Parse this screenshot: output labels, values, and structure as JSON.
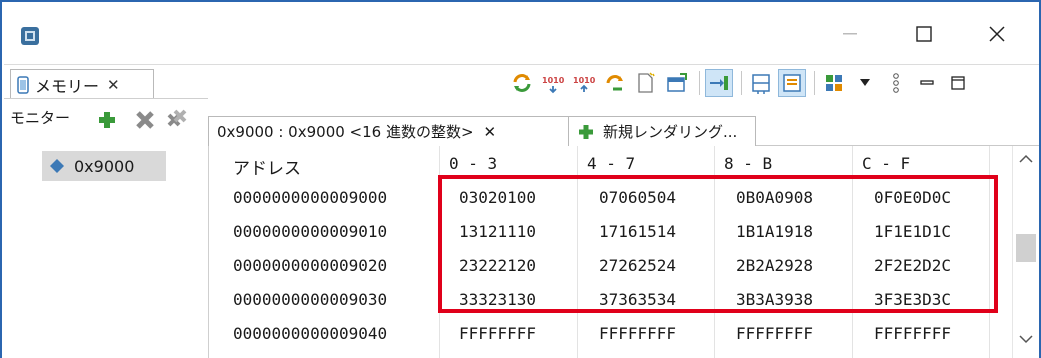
{
  "window": {
    "minimize_label": "—",
    "maximize_label": "☐",
    "close_label": "✕"
  },
  "view_tab": {
    "label": "メモリー",
    "close_label": "✕"
  },
  "monitors": {
    "title": "モニター",
    "items": [
      {
        "label": "0x9000"
      }
    ]
  },
  "rendering_tabs": {
    "selected": {
      "label": "0x9000 : 0x9000 <16 進数の整数>",
      "close_label": "✕"
    },
    "new_rendering": {
      "label": "新規レンダリング..."
    }
  },
  "memory_table": {
    "columns": [
      "アドレス",
      "0 - 3",
      "4 - 7",
      "8 - B",
      "C - F"
    ],
    "rows": [
      {
        "address": "0000000000009000",
        "values": [
          "03020100",
          "07060504",
          "0B0A0908",
          "0F0E0D0C"
        ]
      },
      {
        "address": "0000000000009010",
        "values": [
          "13121110",
          "17161514",
          "1B1A1918",
          "1F1E1D1C"
        ]
      },
      {
        "address": "0000000000009020",
        "values": [
          "23222120",
          "27262524",
          "2B2A2928",
          "2F2E2D2C"
        ]
      },
      {
        "address": "0000000000009030",
        "values": [
          "33323130",
          "37363534",
          "3B3A3938",
          "3F3E3D3C"
        ]
      },
      {
        "address": "0000000000009040",
        "values": [
          "FFFFFFFF",
          "FFFFFFFF",
          "FFFFFFFF",
          "FFFFFFFF"
        ]
      }
    ]
  },
  "colors": {
    "highlight": "#e0001a",
    "window_border": "#2b66b0",
    "selected_item_bg": "#d9d9d9"
  }
}
